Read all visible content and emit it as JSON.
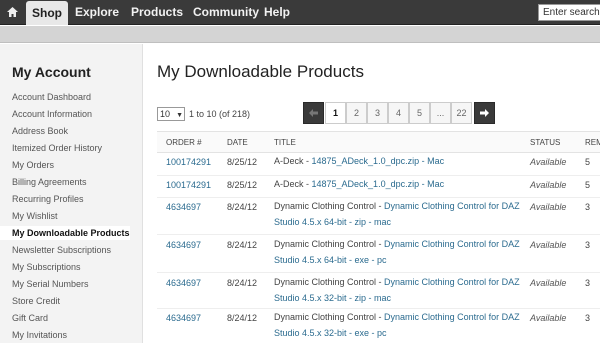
{
  "nav": {
    "items": [
      "Shop",
      "Explore",
      "Products",
      "Community",
      "Help"
    ],
    "active": "Shop",
    "search_placeholder": "Enter search k"
  },
  "sidebar": {
    "title": "My Account",
    "items": [
      "Account Dashboard",
      "Account Information",
      "Address Book",
      "Itemized Order History",
      "My Orders",
      "Billing Agreements",
      "Recurring Profiles",
      "My Wishlist",
      "My Downloadable Products",
      "Newsletter Subscriptions",
      "My Subscriptions",
      "My Serial Numbers",
      "Store Credit",
      "Gift Card",
      "My Invitations"
    ],
    "active_index": 8
  },
  "main": {
    "title": "My Downloadable Products",
    "per_page": "10",
    "range": "1 to 10 (of 218)",
    "pages": [
      "1",
      "2",
      "3",
      "4",
      "5",
      "...",
      "22"
    ],
    "current_page": "1",
    "columns": [
      "ORDER #",
      "DATE",
      "TITLE",
      "STATUS",
      "REM"
    ],
    "rows": [
      {
        "order": "100174291",
        "date": "8/25/12",
        "title_prefix": "A-Deck - ",
        "title_link": "14875_ADeck_1.0_dpc.zip - Mac",
        "title_link2": "",
        "status": "Available",
        "remaining": "5"
      },
      {
        "order": "100174291",
        "date": "8/25/12",
        "title_prefix": "A-Deck - ",
        "title_link": "14875_ADeck_1.0_dpc.zip - Mac",
        "title_link2": "",
        "status": "Available",
        "remaining": "5"
      },
      {
        "order": "4634697",
        "date": "8/24/12",
        "title_prefix": "Dynamic Clothing Control - ",
        "title_link": "Dynamic Clothing Control for DAZ",
        "title_link2": "Studio 4.5.x 64-bit - zip - mac",
        "status": "Available",
        "remaining": "3"
      },
      {
        "order": "4634697",
        "date": "8/24/12",
        "title_prefix": "Dynamic Clothing Control - ",
        "title_link": "Dynamic Clothing Control for DAZ",
        "title_link2": "Studio 4.5.x 64-bit - exe - pc",
        "status": "Available",
        "remaining": "3"
      },
      {
        "order": "4634697",
        "date": "8/24/12",
        "title_prefix": "Dynamic Clothing Control - ",
        "title_link": "Dynamic Clothing Control for DAZ",
        "title_link2": "Studio 4.5.x 32-bit - zip - mac",
        "status": "Available",
        "remaining": "3"
      },
      {
        "order": "4634697",
        "date": "8/24/12",
        "title_prefix": "Dynamic Clothing Control - ",
        "title_link": "Dynamic Clothing Control for DAZ",
        "title_link2": "Studio 4.5.x 32-bit - exe - pc",
        "status": "Available",
        "remaining": "3"
      }
    ]
  },
  "icons": {
    "home": "home-icon",
    "prev": "arrow-left-icon",
    "next": "arrow-right-icon",
    "dropdown": "chevron-down-icon"
  },
  "colors": {
    "nav_bg": "#3a3a3a",
    "link": "#2b6b8f",
    "sidebar_bg": "#f3f3f3"
  }
}
